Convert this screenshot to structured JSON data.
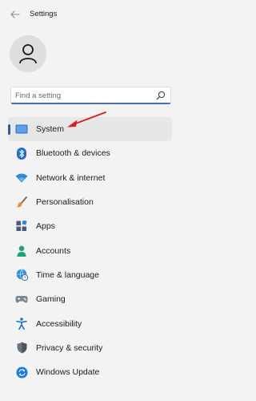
{
  "window": {
    "title": "Settings"
  },
  "search": {
    "placeholder": "Find a setting"
  },
  "sidebar": {
    "items": [
      {
        "label": "System",
        "icon": "system-icon",
        "selected": true
      },
      {
        "label": "Bluetooth & devices",
        "icon": "bluetooth-icon"
      },
      {
        "label": "Network & internet",
        "icon": "wifi-icon"
      },
      {
        "label": "Personalisation",
        "icon": "brush-icon"
      },
      {
        "label": "Apps",
        "icon": "apps-icon"
      },
      {
        "label": "Accounts",
        "icon": "person-icon"
      },
      {
        "label": "Time & language",
        "icon": "globe-clock-icon"
      },
      {
        "label": "Gaming",
        "icon": "gamepad-icon"
      },
      {
        "label": "Accessibility",
        "icon": "accessibility-icon"
      },
      {
        "label": "Privacy & security",
        "icon": "shield-icon"
      },
      {
        "label": "Windows Update",
        "icon": "update-icon"
      }
    ]
  },
  "colors": {
    "accent": "#2e5d95",
    "annotation_arrow": "#d81f26"
  }
}
